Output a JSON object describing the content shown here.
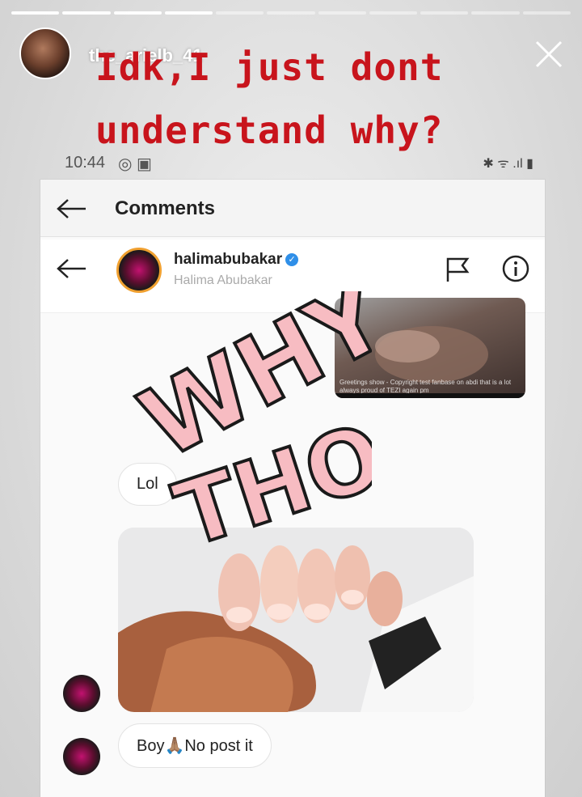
{
  "story": {
    "username": "the_arielb_41",
    "caption_line1": "Idk,I just dont",
    "caption_line2": "understand why?",
    "progress_segments_total": 11,
    "progress_segments_done": 4
  },
  "phone_status": {
    "time": "10:44",
    "left_icons": "◎ ▣",
    "right_icons": "✱ ᯤ .ıl ▮"
  },
  "comments": {
    "title": "Comments"
  },
  "user": {
    "username": "halimabubakar",
    "full_name": "Halima Abubakar",
    "verified_mark": "✓"
  },
  "thumbnail": {
    "caption": "Greetings show - Copyright test fanbase on abdi that is a lot always proud of TEZI again pm"
  },
  "messages": [
    {
      "text": "Lol"
    },
    {
      "text": "Boy🙏🏽No post it"
    }
  ],
  "sticker": {
    "line1": "WHY",
    "line2": "THO"
  },
  "colors": {
    "caption_red": "#c8141c",
    "sticker_pink": "#f7bcc2",
    "verified_blue": "#2f8fe8"
  }
}
